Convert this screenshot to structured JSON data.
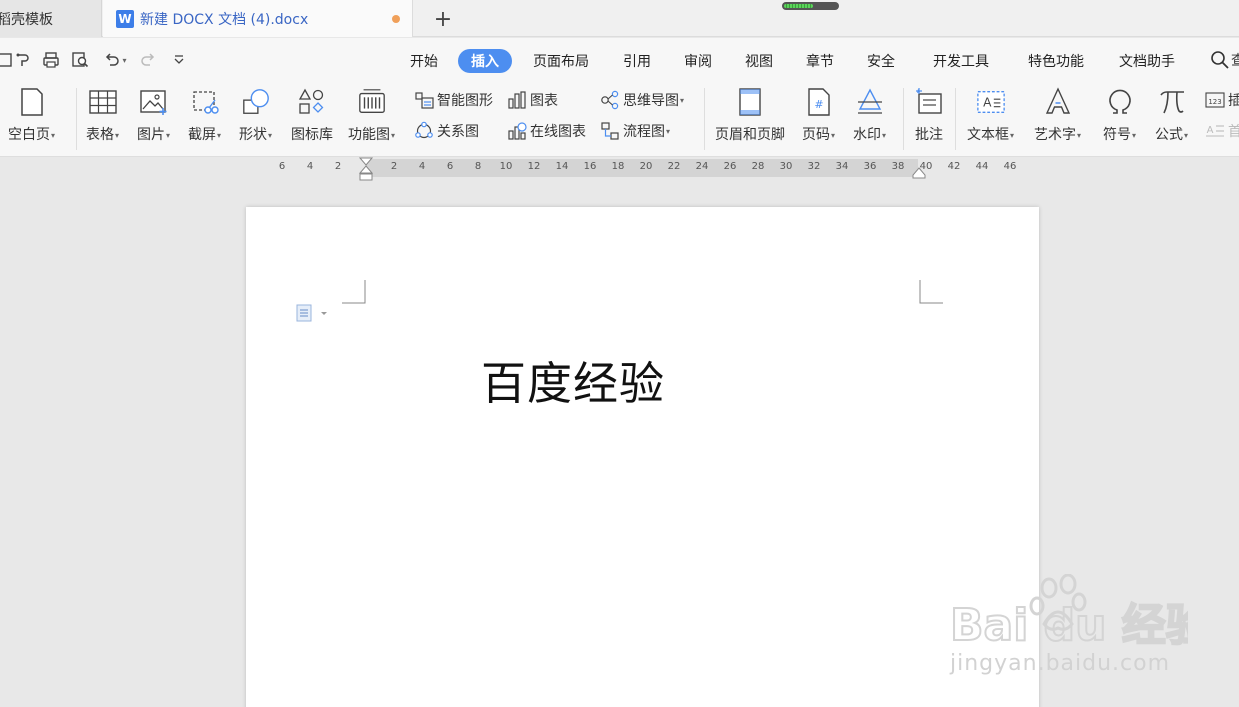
{
  "tabs": {
    "inactive_label": "稻壳模板",
    "active_label": "新建 DOCX 文档 (4).docx",
    "active_icon": "W",
    "new_tab": "+"
  },
  "progress": {
    "fraction": 0.55
  },
  "menu": {
    "items": [
      "开始",
      "插入",
      "页面布局",
      "引用",
      "审阅",
      "视图",
      "章节",
      "安全",
      "开发工具",
      "特色功能",
      "文档助手"
    ],
    "active": "插入",
    "search_label": "查"
  },
  "ribbon": {
    "blank_page": "空白页",
    "table": "表格",
    "picture": "图片",
    "screenshot": "截屏",
    "shape": "形状",
    "icon_library": "图标库",
    "function_chart": "功能图",
    "smart_art": "智能图形",
    "relation_chart": "关系图",
    "chart": "图表",
    "online_chart": "在线图表",
    "mind_map": "思维导图",
    "flowchart": "流程图",
    "header_footer": "页眉和页脚",
    "page_number": "页码",
    "watermark": "水印",
    "comment": "批注",
    "textbox": "文本框",
    "word_art": "艺术字",
    "symbol": "符号",
    "formula": "公式",
    "insert_number": "插",
    "first_letter": "首"
  },
  "ruler": {
    "left_numbers": [
      "6",
      "4",
      "2"
    ],
    "right_numbers": [
      "2",
      "4",
      "6",
      "8",
      "10",
      "12",
      "14",
      "16",
      "18",
      "20",
      "22",
      "24",
      "26",
      "28",
      "30",
      "32",
      "34",
      "36",
      "38",
      "40",
      "42",
      "44",
      "46"
    ]
  },
  "document": {
    "text": "百度经验"
  },
  "watermark": {
    "brand": "Bai du 经验",
    "url": "jingyan.baidu.com"
  },
  "colors": {
    "accent": "#4d8ef0",
    "tab_text": "#3a66c4",
    "unsaved_dot": "#f0a05a"
  }
}
